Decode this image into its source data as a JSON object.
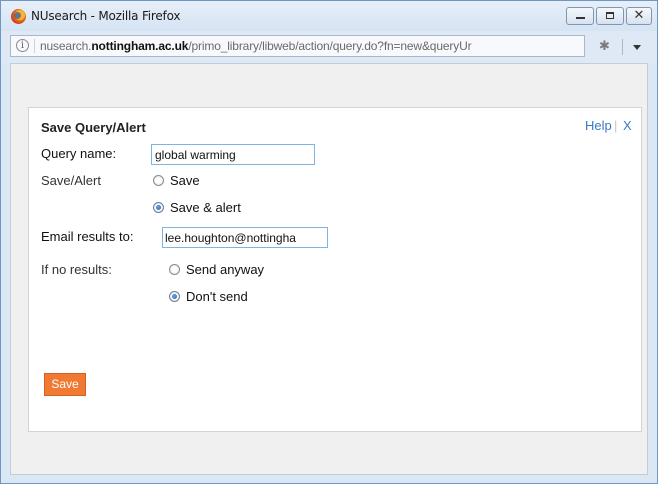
{
  "window": {
    "title": "NUsearch - Mozilla Firefox",
    "close_glyph": "✕"
  },
  "urlbar": {
    "info_glyph": "i",
    "url_prefix": "nusearch.",
    "url_domain": "nottingham.ac.uk",
    "url_path": "/primo_library/libweb/action/query.do?fn=new&queryUr",
    "extension_glyph": "✱"
  },
  "dialog": {
    "title": "Save Query/Alert",
    "help_label": "Help",
    "separator": "|",
    "close_label": "X",
    "query_name_label": "Query name:",
    "query_name_value": "global warming",
    "save_alert_label": "Save/Alert",
    "options_save": "Save",
    "options_save_alert": "Save & alert",
    "save_alert_selected": "Save & alert",
    "email_label": "Email results to:",
    "email_value": "lee.houghton@nottingha",
    "no_results_label": "If no results:",
    "no_results_send": "Send anyway",
    "no_results_dont": "Don't send",
    "no_results_selected": "Don't send",
    "save_button": "Save"
  },
  "colors": {
    "accent_button": "#f07a33",
    "link": "#3a78c4",
    "field_border": "#7eb4e4",
    "window_frame": "#6d97c4"
  },
  "icons": {
    "browser_logo": "firefox-logo-icon",
    "info": "info-icon",
    "extension": "puzzle-icon",
    "menu": "chevron-down-icon"
  }
}
